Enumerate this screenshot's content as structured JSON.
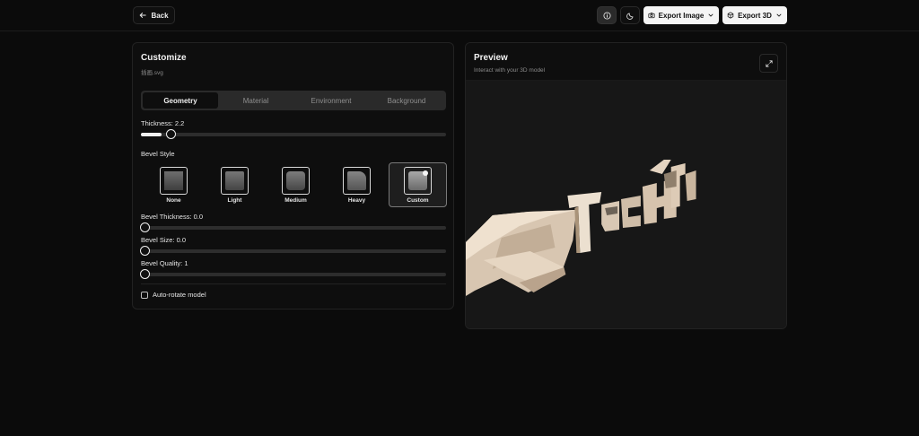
{
  "topbar": {
    "back_label": "Back",
    "export_image_label": "Export Image",
    "export_3d_label": "Export 3D"
  },
  "customize": {
    "title": "Customize",
    "filename": "插画.svg",
    "tabs": [
      {
        "label": "Geometry",
        "active": true
      },
      {
        "label": "Material",
        "active": false
      },
      {
        "label": "Environment",
        "active": false
      },
      {
        "label": "Background",
        "active": false
      }
    ],
    "thickness_label": "Thickness: 2.2",
    "thickness_fraction": 0.055,
    "bevel_style_label": "Bevel Style",
    "bevel_options": [
      {
        "label": "None"
      },
      {
        "label": "Light"
      },
      {
        "label": "Medium"
      },
      {
        "label": "Heavy"
      },
      {
        "label": "Custom",
        "selected": true
      }
    ],
    "bevel_thickness_label": "Bevel Thickness: 0.0",
    "bevel_size_label": "Bevel Size: 0.0",
    "bevel_quality_label": "Bevel Quality: 1",
    "auto_rotate_label": "Auto-rotate model",
    "auto_rotate_checked": false
  },
  "preview": {
    "title": "Preview",
    "subtitle": "Interact with your 3D model"
  }
}
